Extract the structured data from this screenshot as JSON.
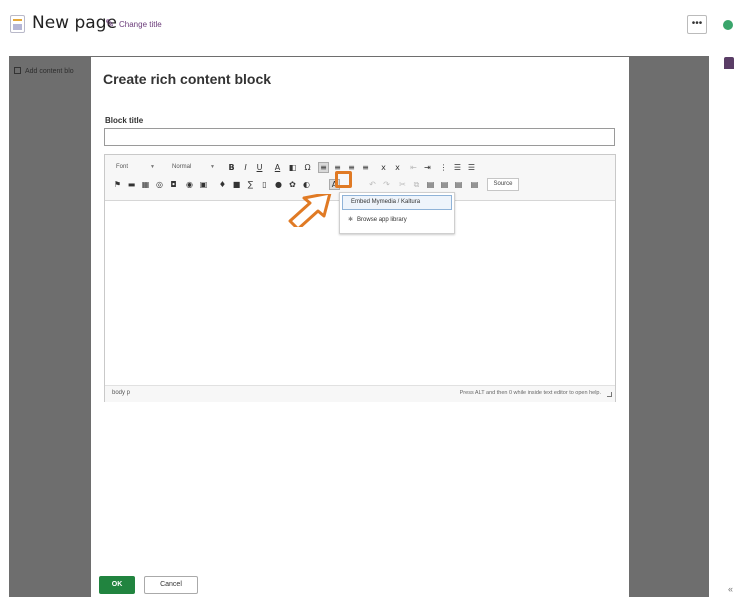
{
  "header": {
    "page_title": "New page",
    "change_title_label": "Change title",
    "more_label": "•••"
  },
  "background": {
    "add_content_label": "Add content blo"
  },
  "modal": {
    "title": "Create rich content block",
    "block_title_label": "Block title",
    "block_title_value": ""
  },
  "editor": {
    "toolbar": {
      "font_combo": "Font",
      "format_combo": "Normal",
      "source_label": "Source"
    },
    "status": {
      "path": "body  p",
      "help_text": "Press ALT and then 0 while inside text editor to open help."
    },
    "dropdown": {
      "items": [
        {
          "label": "Embed Mymedia / Kaltura"
        },
        {
          "label": "Browse app library"
        }
      ]
    }
  },
  "footer": {
    "ok_label": "OK",
    "cancel_label": "Cancel"
  },
  "colors": {
    "ok_green": "#21843f",
    "highlight_orange": "#e07a24",
    "overlay_grey": "#6e6e6e",
    "accent_purple": "#6b3c7a"
  },
  "icons": [
    "page-icon",
    "pencil-icon",
    "more-icon",
    "eye-icon",
    "user-icon",
    "puzzle-icon",
    "arrow-icon"
  ]
}
